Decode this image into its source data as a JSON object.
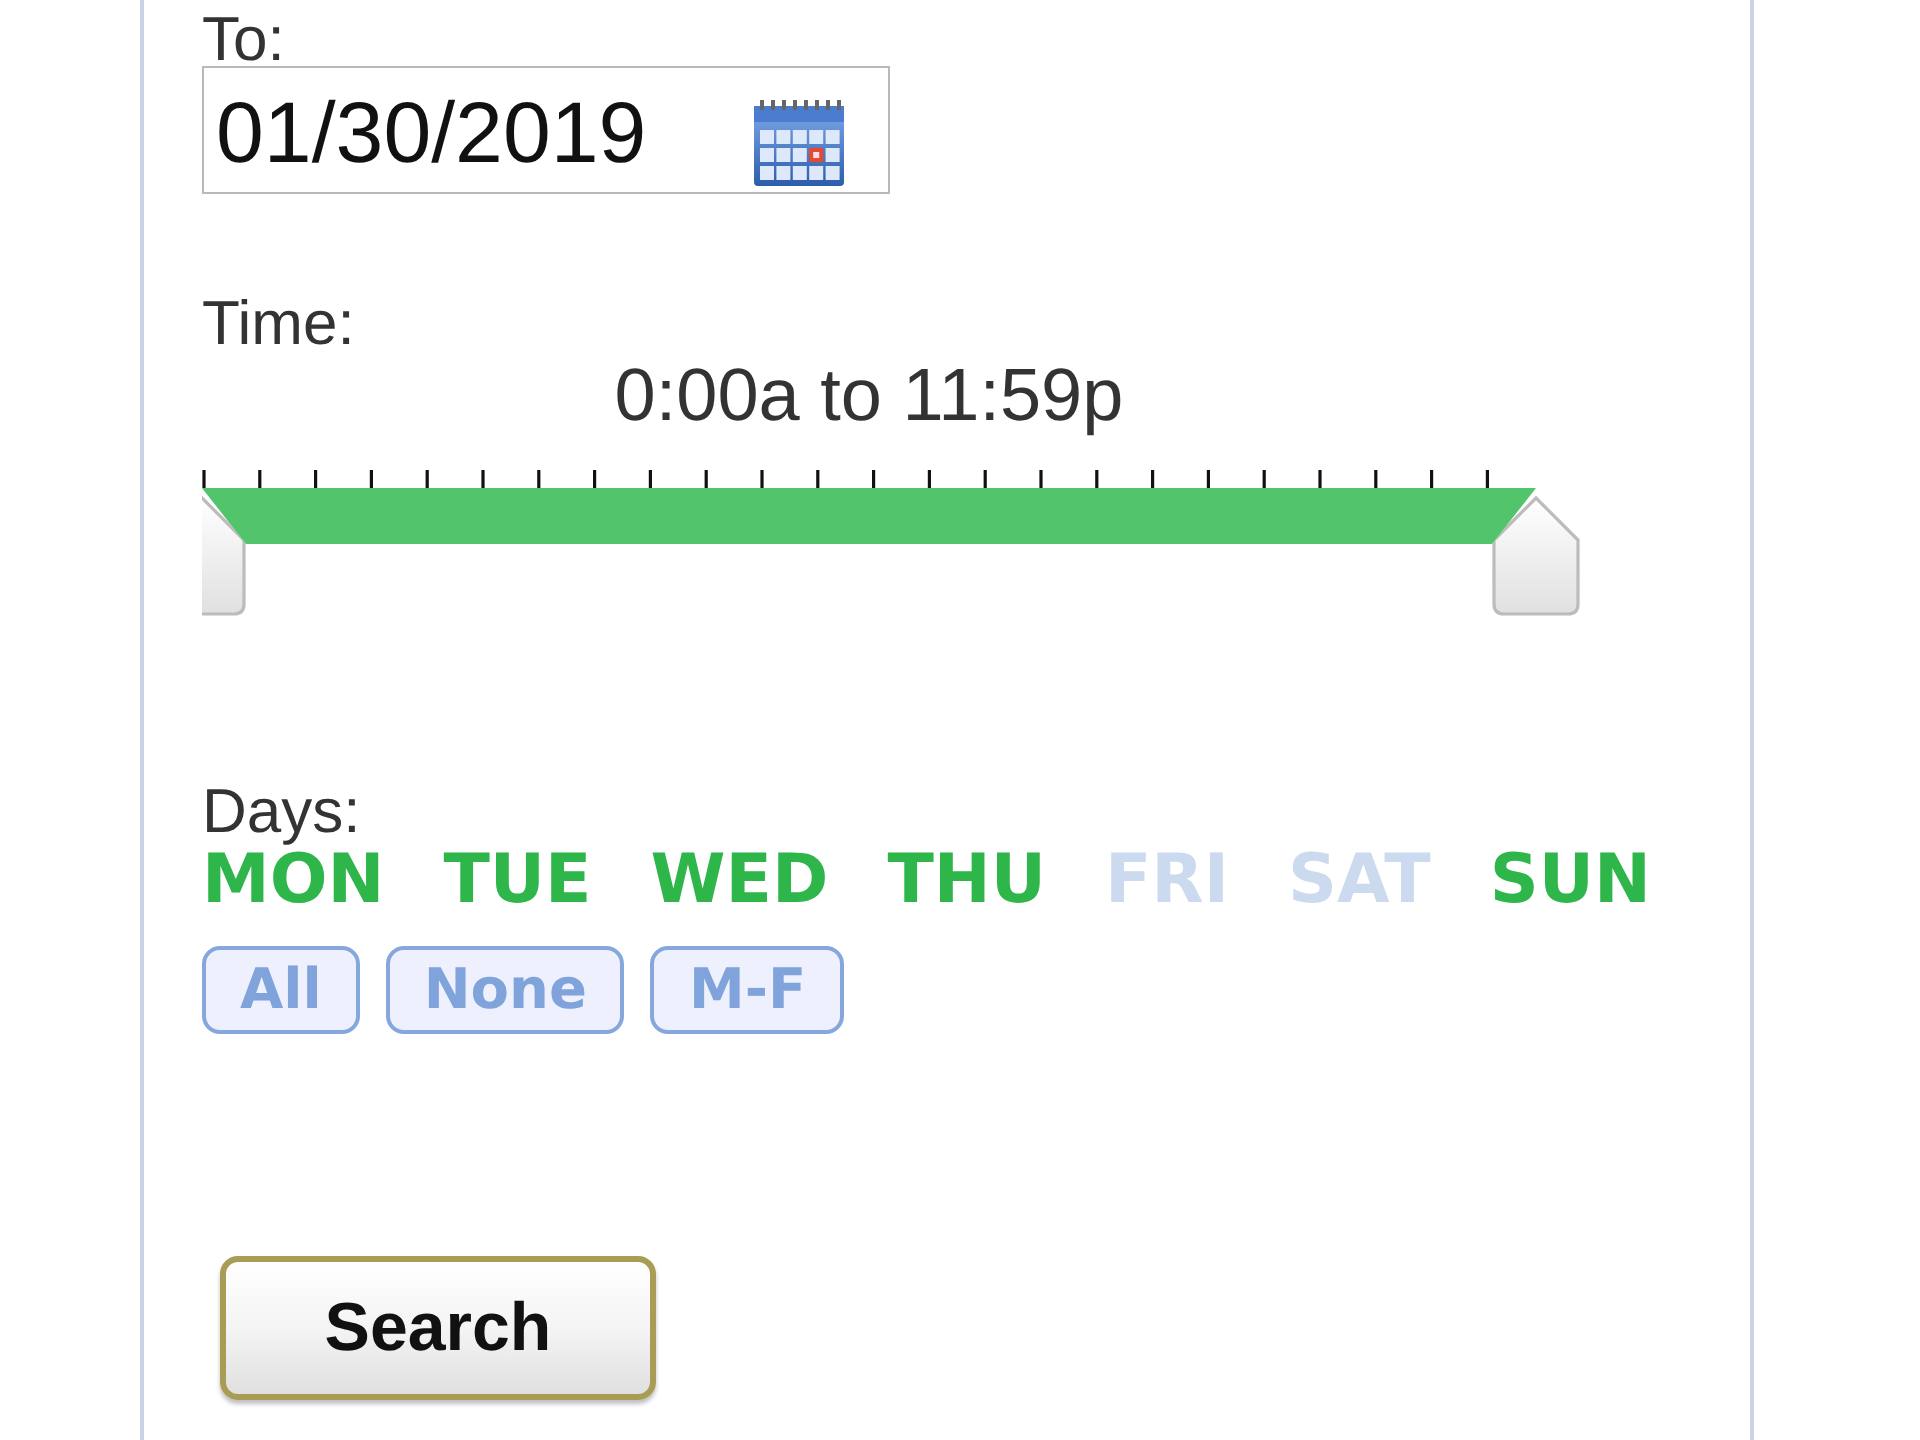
{
  "to": {
    "label": "To:",
    "date": "01/30/2019"
  },
  "time": {
    "label": "Time:",
    "reading": "0:00a to 11:59p",
    "handles": [
      {
        "level": 0
      },
      {
        "level": 1
      }
    ]
  },
  "days": {
    "label": "Days:",
    "items": [
      {
        "label": "MON",
        "selected": true
      },
      {
        "label": "TUE",
        "selected": true
      },
      {
        "label": "WED",
        "selected": true
      },
      {
        "label": "THU",
        "selected": true
      },
      {
        "label": "FRI",
        "selected": false
      },
      {
        "label": "SAT",
        "selected": false
      },
      {
        "label": "SUN",
        "selected": true
      }
    ],
    "buttons": [
      "All",
      "None",
      "M-F"
    ]
  },
  "search_button": "Search"
}
